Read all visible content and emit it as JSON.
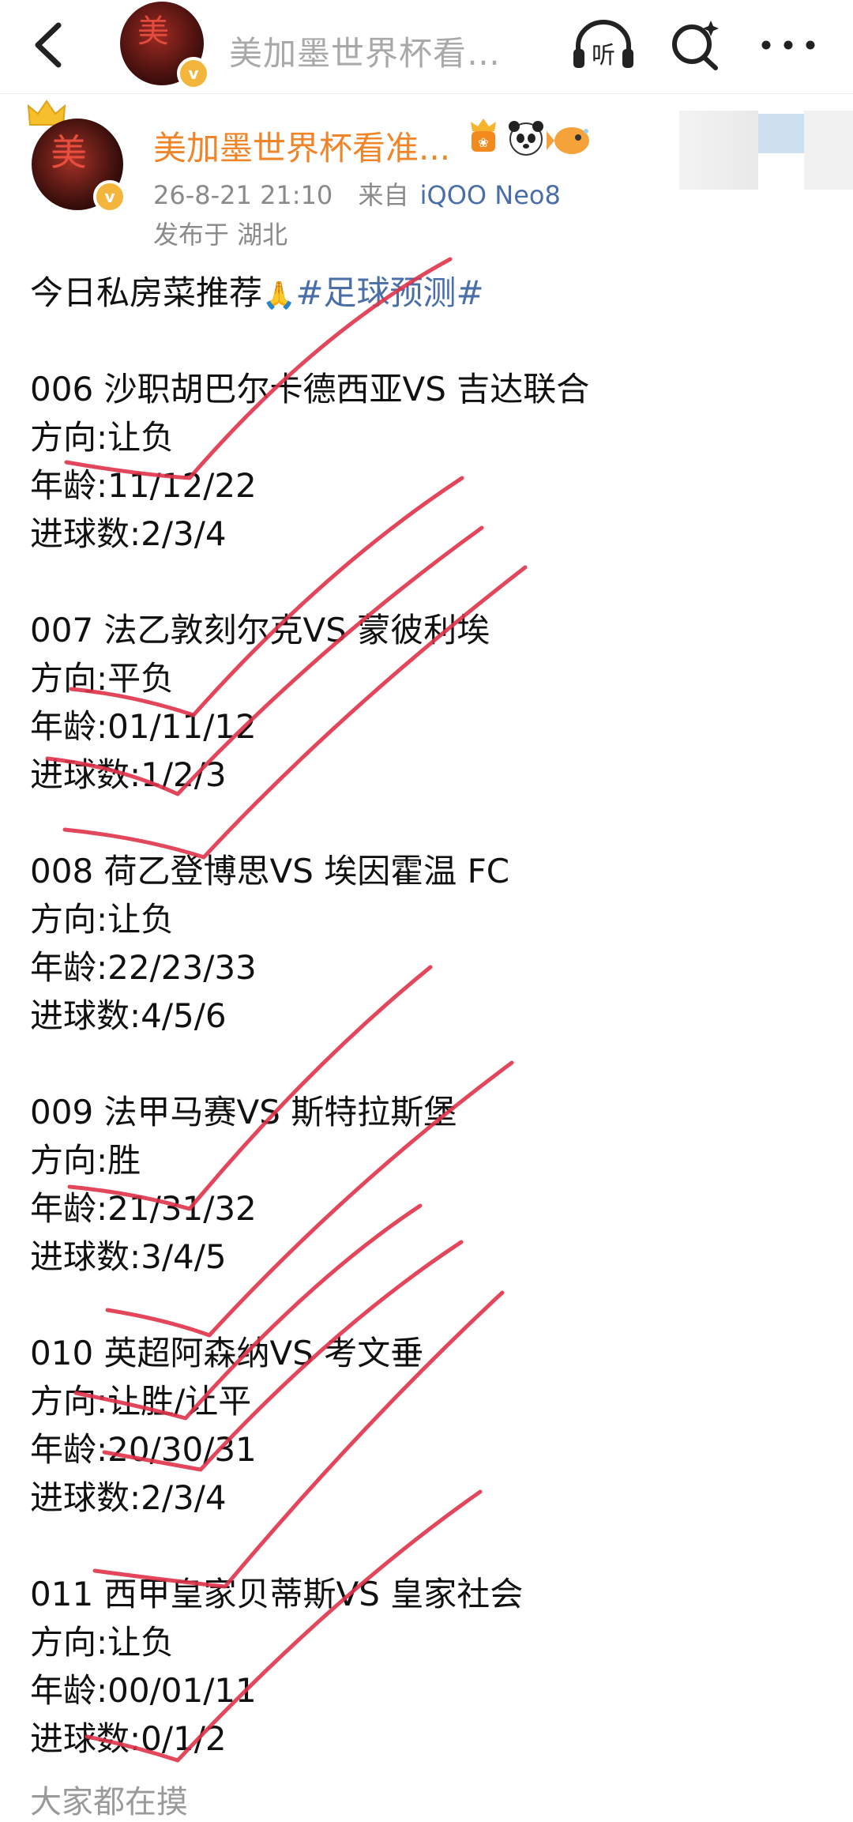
{
  "nav": {
    "title": "美加墨世界杯看…",
    "listen_label": "听"
  },
  "author": {
    "name": "美加墨世界杯看准...",
    "verified_mark": "v",
    "timestamp": "26-8-21 21:10",
    "source_prefix": "来自",
    "device": "iQOO Neo8",
    "location": "发布于 湖北"
  },
  "post": {
    "intro": "今日私房菜推荐",
    "intro_emoji": "🙏",
    "topic": "#足球预测#",
    "matches": [
      {
        "title": "006 沙职胡巴尔卡德西亚VS 吉达联合",
        "direction": "方向:让负",
        "age": "年龄:11/12/22",
        "goals": "进球数:2/3/4"
      },
      {
        "title": "007 法乙敦刻尔克VS 蒙彼利埃",
        "direction": "方向:平负",
        "age": "年龄:01/11/12",
        "goals": "进球数:1/2/3"
      },
      {
        "title": "008 荷乙登博思VS 埃因霍温 FC",
        "direction": "方向:让负",
        "age": "年龄:22/23/33",
        "goals": "进球数:4/5/6"
      },
      {
        "title": "009 法甲马赛VS 斯特拉斯堡",
        "direction": "方向:胜",
        "age": "年龄:21/31/32",
        "goals": "进球数:3/4/5"
      },
      {
        "title": "010 英超阿森纳VS 考文垂",
        "direction": "方向:让胜/让平",
        "age": "年龄:20/30/31",
        "goals": "进球数:2/3/4"
      },
      {
        "title": "011 西甲皇家贝蒂斯VS 皇家社会",
        "direction": "方向:让负",
        "age": "年龄:00/01/11",
        "goals": "进球数:0/1/2"
      }
    ],
    "truncated_line": "大家都在摸"
  },
  "colors": {
    "author_name": "#f08428",
    "link": "#4a6ea8",
    "meta": "#8a8a8a",
    "check_marks": "#e0334a"
  },
  "icons": [
    "back-arrow-icon",
    "headphones-icon",
    "search-sparkle-icon",
    "more-dots-icon",
    "crown-icon",
    "verified-badge-icon",
    "vip-emoji-icon",
    "panda-emoji-icon",
    "fish-emoji-icon"
  ]
}
